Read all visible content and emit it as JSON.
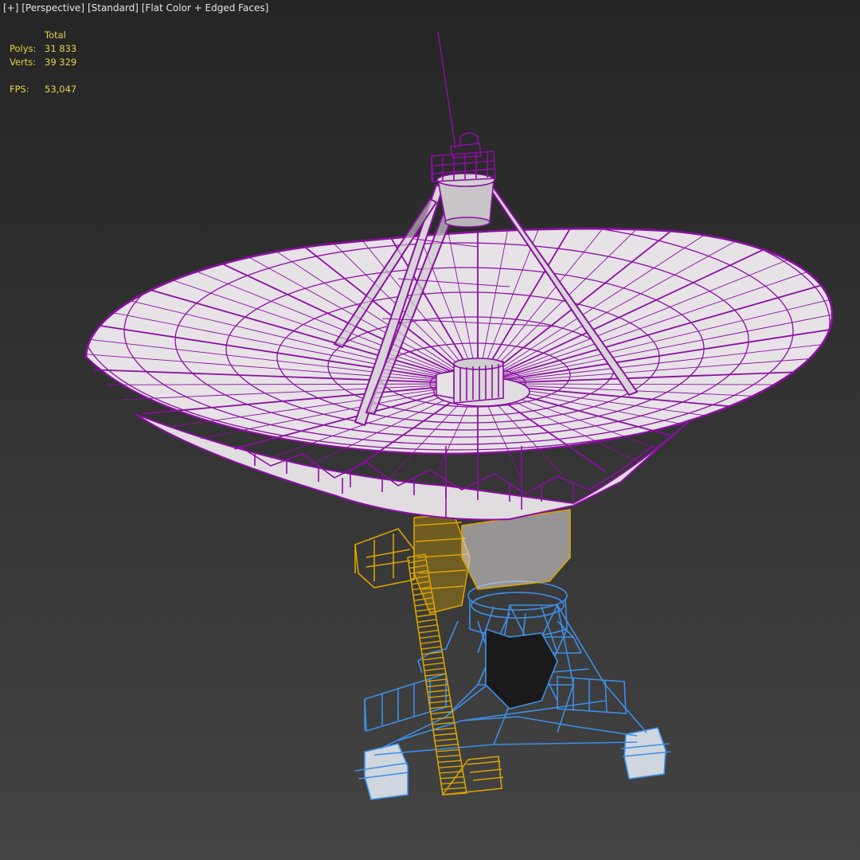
{
  "viewport": {
    "menu_label": "[+]",
    "view_label": "[Perspective]",
    "shading_mode_label": "[Standard]",
    "display_mode_label": "[Flat Color + Edged Faces]"
  },
  "stats": {
    "header": "Total",
    "polys_label": "Polys:",
    "polys_value": "31 833",
    "verts_label": "Verts:",
    "verts_value": "39 329",
    "fps_label": "FPS:",
    "fps_value": "53,047"
  },
  "colors": {
    "dish_wire": "#8a10a0",
    "dish_face": "#e4e0e4",
    "mount_wire": "#d9a400",
    "base_wire": "#3f8fe8",
    "stats_text": "#e8d24a"
  },
  "icons": {
    "model": "radio-telescope-model"
  }
}
